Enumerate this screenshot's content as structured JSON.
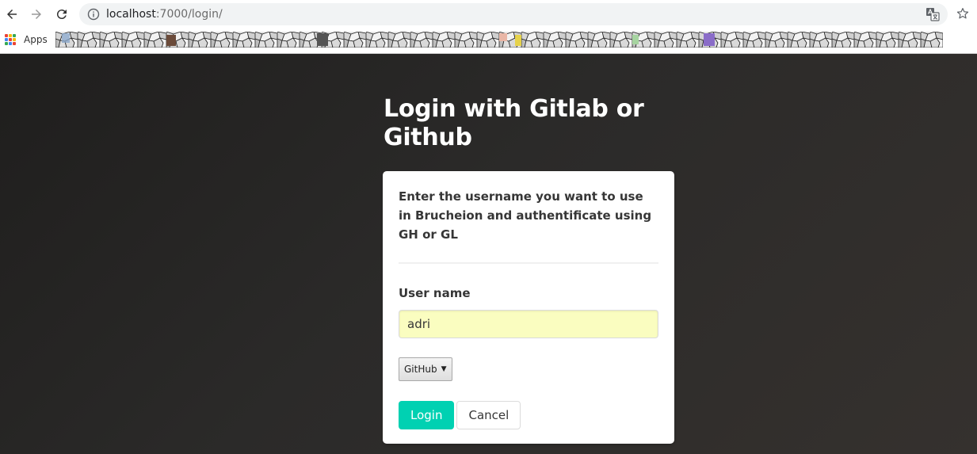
{
  "browser": {
    "url_host": "localhost",
    "url_path": ":7000/login/",
    "bookmarks": {
      "apps_label": "Apps"
    }
  },
  "page": {
    "title": "Login with Gitlab or Github",
    "card": {
      "description": "Enter the username you want to use in Brucheion and authentificate using GH or GL",
      "username_label": "User name",
      "username_value": "adri",
      "provider_selected": "GitHub",
      "login_label": "Login",
      "cancel_label": "Cancel"
    }
  },
  "colors": {
    "primary": "#00d1b2",
    "autofill": "#fafdc0",
    "page_background": "#2a2928"
  }
}
